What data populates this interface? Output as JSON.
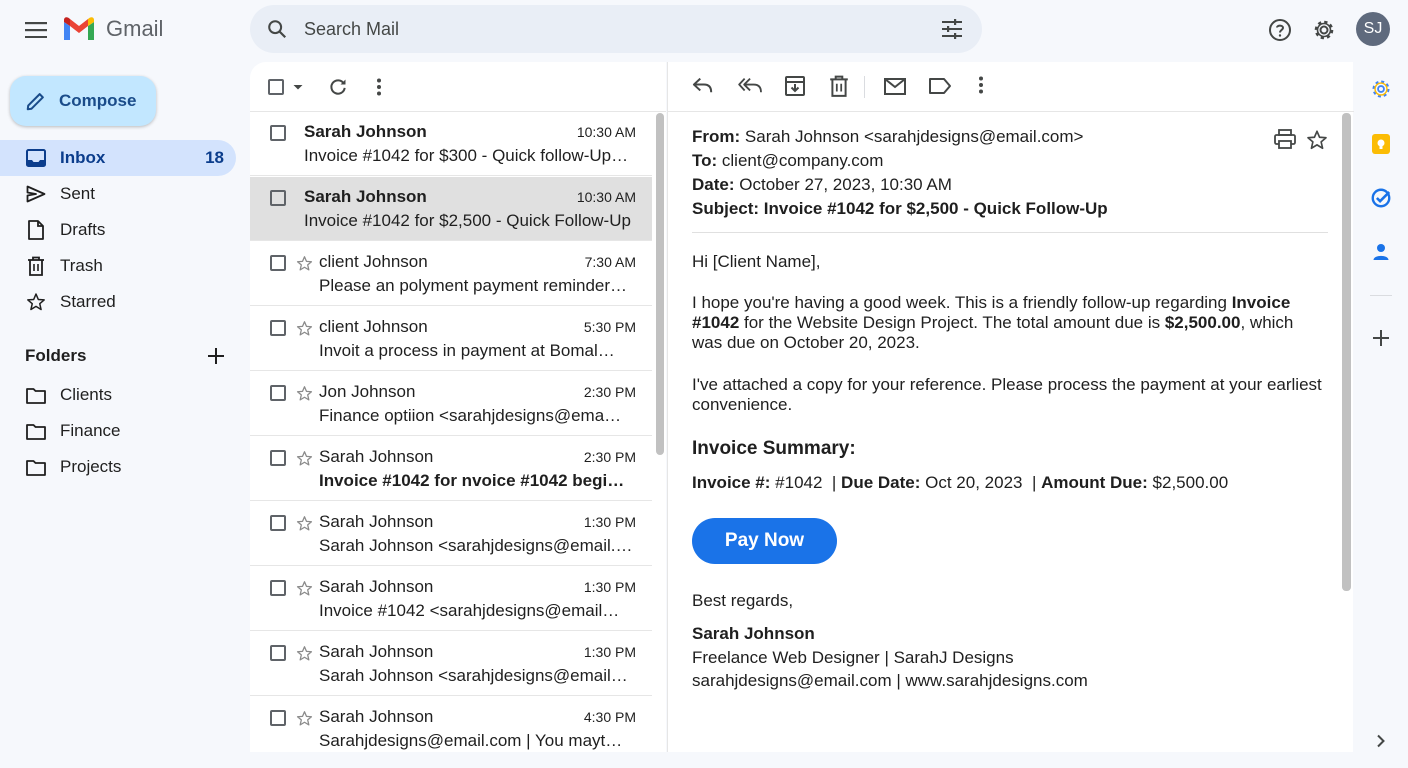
{
  "app": {
    "name": "Gmail"
  },
  "search": {
    "placeholder": "Search Mail"
  },
  "user": {
    "initials": "SJ"
  },
  "compose_label": "Compose",
  "nav": [
    {
      "label": "Inbox",
      "count": "18",
      "icon": "inbox-icon",
      "active": true
    },
    {
      "label": "Sent",
      "icon": "send-icon"
    },
    {
      "label": "Drafts",
      "icon": "draft-icon"
    },
    {
      "label": "Trash",
      "icon": "trash-icon"
    },
    {
      "label": "Starred",
      "icon": "star-icon"
    }
  ],
  "folders": {
    "title": "Folders",
    "items": [
      {
        "label": "Clients"
      },
      {
        "label": "Finance"
      },
      {
        "label": "Projects"
      }
    ]
  },
  "emails": [
    {
      "sender": "Sarah Johnson",
      "time": "10:30 AM",
      "subject": "Invoice #1042 for $300 - Quick follow-Up…",
      "unread": true,
      "starred_icon": false
    },
    {
      "sender": "Sarah Johnson",
      "time": "10:30 AM",
      "subject": "Invoice #1042 for $2,500 - Quick Follow-Up",
      "unread": true,
      "selected": true,
      "starred_icon": false
    },
    {
      "sender": "client Johnson",
      "time": "7:30 AM",
      "subject": "Please an polyment payment reminder…",
      "starred_icon": true
    },
    {
      "sender": "client Johnson",
      "time": "5:30 PM",
      "subject": "Invoit a process in payment at Bomal…",
      "starred_icon": true
    },
    {
      "sender": "Jon Johnson",
      "time": "2:30 PM",
      "subject": "Finance optiion <sarahjdesigns@ema…",
      "starred_icon": true
    },
    {
      "sender": "Sarah Johnson",
      "time": "2:30 PM",
      "subject": "Invoice #1042 for nvoice #1042 begi…",
      "bold_subject": true,
      "starred_icon": true
    },
    {
      "sender": "Sarah Johnson",
      "time": "1:30 PM",
      "subject": "Sarah Johnson <sarahjdesigns@email.…",
      "starred_icon": true
    },
    {
      "sender": "Sarah Johnson",
      "time": "1:30 PM",
      "subject": "Invoice #1042 <sarahjdesigns@email…",
      "starred_icon": true
    },
    {
      "sender": "Sarah Johnson",
      "time": "1:30 PM",
      "subject": "Sarah Johnson <sarahjdesigns@email…",
      "starred_icon": true
    },
    {
      "sender": "Sarah Johnson",
      "time": "4:30 PM",
      "subject": "Sarahjdesigns@email.com | You mayt…",
      "starred_icon": true
    }
  ],
  "message": {
    "from_label": "From:",
    "from": "Sarah Johnson <sarahjdesigns@email.com>",
    "to_label": "To:",
    "to": "client@company.com",
    "date_label": "Date:",
    "date": "October 27, 2023, 10:30 AM",
    "subject_label": "Subject:",
    "subject": "Invoice #1042 for $2,500 - Quick Follow-Up",
    "greeting": "Hi [Client Name],",
    "p1_a": "I hope you're having a good week. This is a friendly follow-up regarding ",
    "p1_b": "Invoice #1042",
    "p1_c": " for the Website Design Project. The total amount due is ",
    "p1_d": "$2,500.00",
    "p1_e": ", which was due on October 20, 2023.",
    "p2": "I've attached a copy for your reference. Please process the payment at your earliest convenience.",
    "summary_title": "Invoice Summary:",
    "inv_label": "Invoice #:",
    "inv_value": "#1042",
    "due_label": "Due Date:",
    "due_value": "Oct 20, 2023",
    "amt_label": "Amount Due:",
    "amt_value": "$2,500.00",
    "sep": "|",
    "pay_button": "Pay Now",
    "closing": "Best regards,",
    "sig_name": "Sarah Johnson",
    "sig_title": "Freelance Web Designer | SarahJ Designs",
    "sig_contact": "sarahjdesigns@email.com | www.sarahjdesigns.com"
  },
  "colors": {
    "accent": "#1a73e8",
    "compose_bg": "#c2e7ff",
    "active_nav": "#d3e3fd",
    "page_bg": "#f6f8fc"
  }
}
